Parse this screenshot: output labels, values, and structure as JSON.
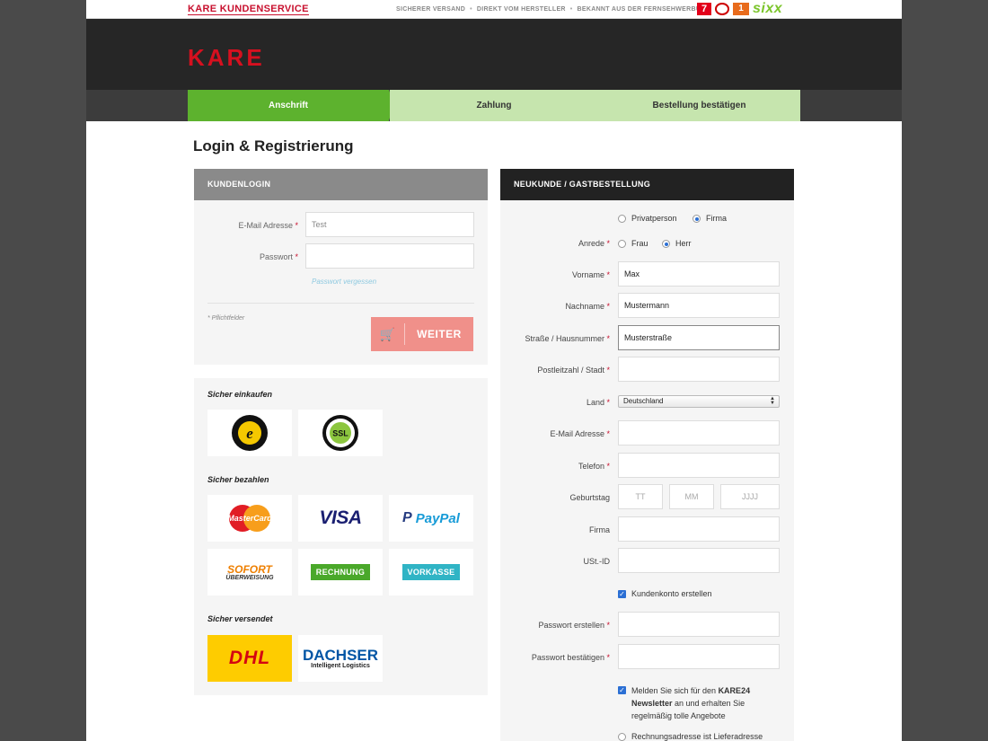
{
  "topbar": {
    "service_link": "KARE KUNDENSERVICE",
    "trust_items": [
      "SICHERER VERSAND",
      "DIREKT VOM HERSTELLER",
      "BEKANNT AUS DER FERNSEHWERBUNG"
    ],
    "tv_logos": [
      "ProSieben",
      "Sat.1",
      "kabel eins",
      "sixx"
    ]
  },
  "header": {
    "logo": "KARE"
  },
  "steps": [
    "Anschrift",
    "Zahlung",
    "Bestellung bestätigen"
  ],
  "page": {
    "title": "Login & Registrierung"
  },
  "login": {
    "heading": "KUNDENLOGIN",
    "email_label": "E-Mail Adresse",
    "email_value": "Test",
    "password_label": "Passwort",
    "password_value": "",
    "forgot": "Passwort vergessen",
    "required_note": "Pflichtfelder",
    "submit": "WEITER"
  },
  "trust": {
    "secure_shopping": "Sicher einkaufen",
    "secure_pay": "Sicher bezahlen",
    "secure_ship": "Sicher versendet",
    "badges": {
      "trusted": "TRUSTED SHOPS GUARANTEE",
      "ssl": "SSL",
      "mastercard": "MasterCard",
      "visa": "VISA",
      "paypal": "PayPal",
      "sofort_top": "SOFORT",
      "sofort_bottom": "ÜBERWEISUNG",
      "rechnung": "RECHNUNG",
      "vorkasse": "VORKASSE",
      "dhl": "DHL",
      "dachser": "DACHSER",
      "dachser_sub": "Intelligent Logistics"
    }
  },
  "register": {
    "heading": "NEUKUNDE / GASTBESTELLUNG",
    "type_options": [
      "Privatperson",
      "Firma"
    ],
    "type_selected": "Firma",
    "salutation_label": "Anrede",
    "salutation_options": [
      "Frau",
      "Herr"
    ],
    "salutation_selected": "Herr",
    "firstname_label": "Vorname",
    "firstname_value": "Max",
    "lastname_label": "Nachname",
    "lastname_value": "Mustermann",
    "street_label": "Straße / Hausnummer",
    "street_value": "Musterstraße",
    "zip_label": "Postleitzahl / Stadt",
    "zip_value": "",
    "country_label": "Land",
    "country_value": "Deutschland",
    "email_label": "E-Mail Adresse",
    "phone_label": "Telefon",
    "birthday_label": "Geburtstag",
    "birthday_placeholders": [
      "TT",
      "MM",
      "JJJJ"
    ],
    "company_label": "Firma",
    "vat_label": "USt.-ID",
    "create_account": "Kundenkonto erstellen",
    "password_create_label": "Passwort erstellen",
    "password_confirm_label": "Passwort bestätigen",
    "newsletter_line1_a": "Melden Sie sich für den ",
    "newsletter_line1_b": "KARE24",
    "newsletter_line2_a": "Newsletter",
    "newsletter_line2_b": " an und erhalten Sie",
    "newsletter_line3": "regelmäßig  tolle Angebote",
    "billing_partial": "Rechnungsadresse ist Lieferadresse"
  },
  "colors": {
    "brand_red": "#d6101f",
    "step_active": "#5db22e",
    "step_inactive": "#c6e5ae",
    "button": "#f0908a"
  }
}
